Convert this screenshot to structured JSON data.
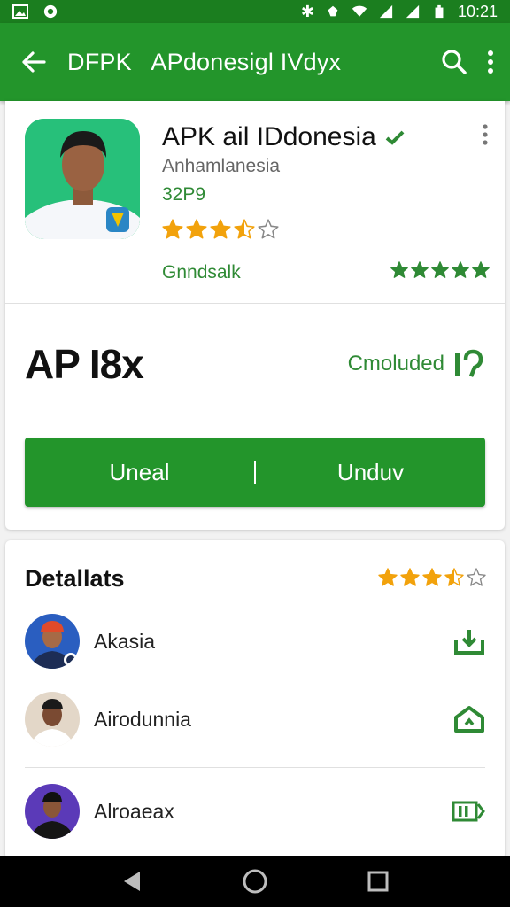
{
  "status_bar": {
    "time": "10:21",
    "icons": [
      "image-icon",
      "notification-icon",
      "bluetooth-icon",
      "vibrate-icon",
      "wifi-icon",
      "signal-icon",
      "signal-icon-2",
      "battery-icon"
    ]
  },
  "app_bar": {
    "title": "DFPK   APdonesigl IVdyx",
    "icons": [
      "back-arrow-icon",
      "search-icon",
      "more-vert-icon"
    ]
  },
  "app": {
    "name": "APK ail IDdonesia",
    "developer": "Anhamlanesia",
    "size": "32P9",
    "rating_stars": 3.5,
    "genre": "Gnndsalk",
    "genre_rating_stars": 5
  },
  "install": {
    "title": "AP I8x",
    "status": "Cmoluded",
    "buttons": {
      "left": "Uneal",
      "right": "Unduv"
    }
  },
  "details": {
    "title": "Detallats",
    "rating_stars": 3.5,
    "items": [
      {
        "label": "Akasia",
        "action_icon": "download-tray-icon"
      },
      {
        "label": "Airodunnia",
        "action_icon": "house-upload-icon"
      },
      {
        "label": "Alroaeax",
        "action_icon": "battery-forward-icon"
      }
    ]
  },
  "colors": {
    "primary": "#23952b",
    "primary_dark": "#1b7e1f",
    "accent_text": "#2f8a35",
    "star": "#f2a20c"
  }
}
